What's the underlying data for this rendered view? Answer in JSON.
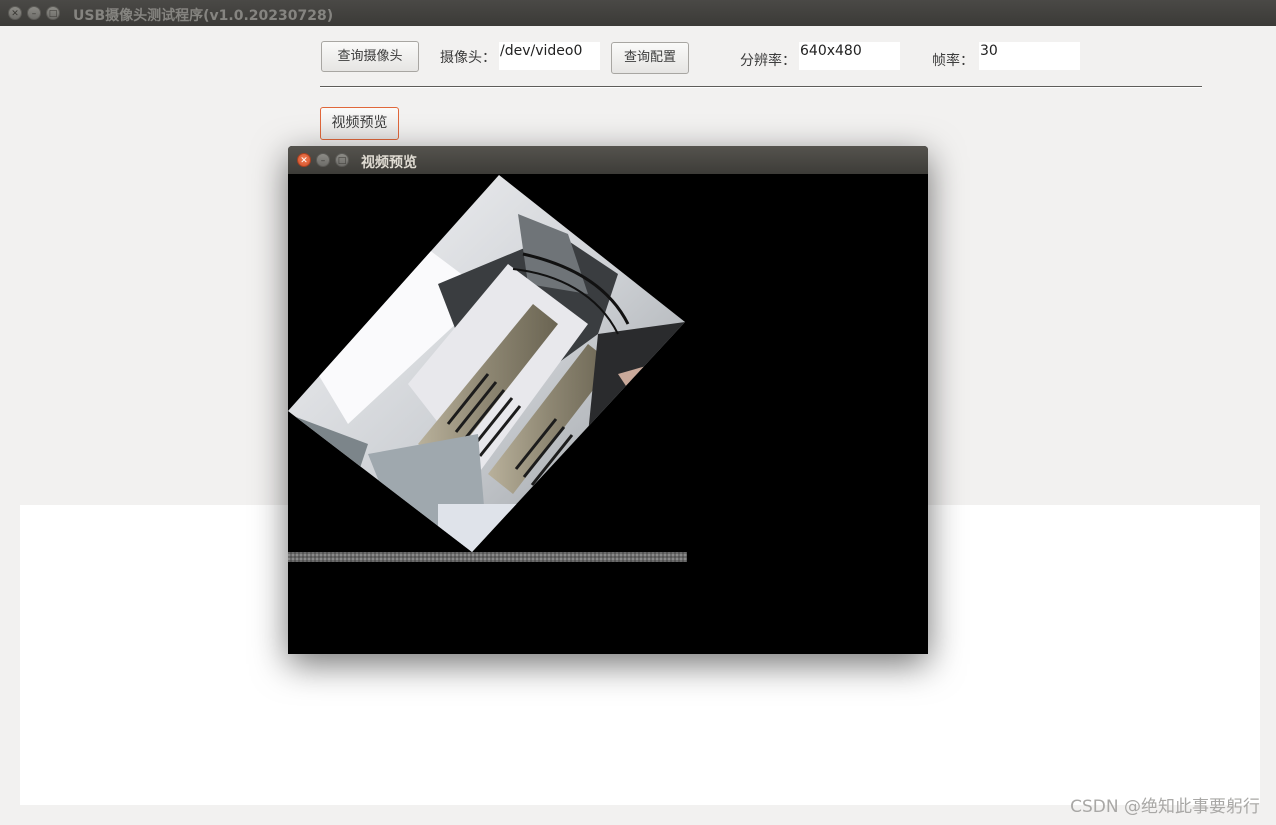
{
  "main_window": {
    "title": "USB摄像头测试程序(v1.0.20230728)"
  },
  "toolbar": {
    "query_camera_label": "查询摄像头",
    "camera_label": "摄像头：",
    "camera_value": "/dev/video0",
    "query_config_label": "查询配置",
    "resolution_label": "分辨率：",
    "resolution_value": "640x480",
    "framerate_label": "帧率：",
    "framerate_value": "30"
  },
  "actions": {
    "video_preview_label": "视频预览"
  },
  "preview_window": {
    "title": "视频预览",
    "content": "rotated camera frame showing a gray metal rack with slotted panels and cables"
  },
  "watermark": "CSDN @绝知此事要躬行",
  "icons": [
    "close-icon",
    "minimize-icon",
    "maximize-icon"
  ],
  "colors": {
    "titlebar": "#3c3b37",
    "close_button_active": "#e9643a",
    "preview_button_border": "#e0673a",
    "background": "#f2f1f0"
  }
}
